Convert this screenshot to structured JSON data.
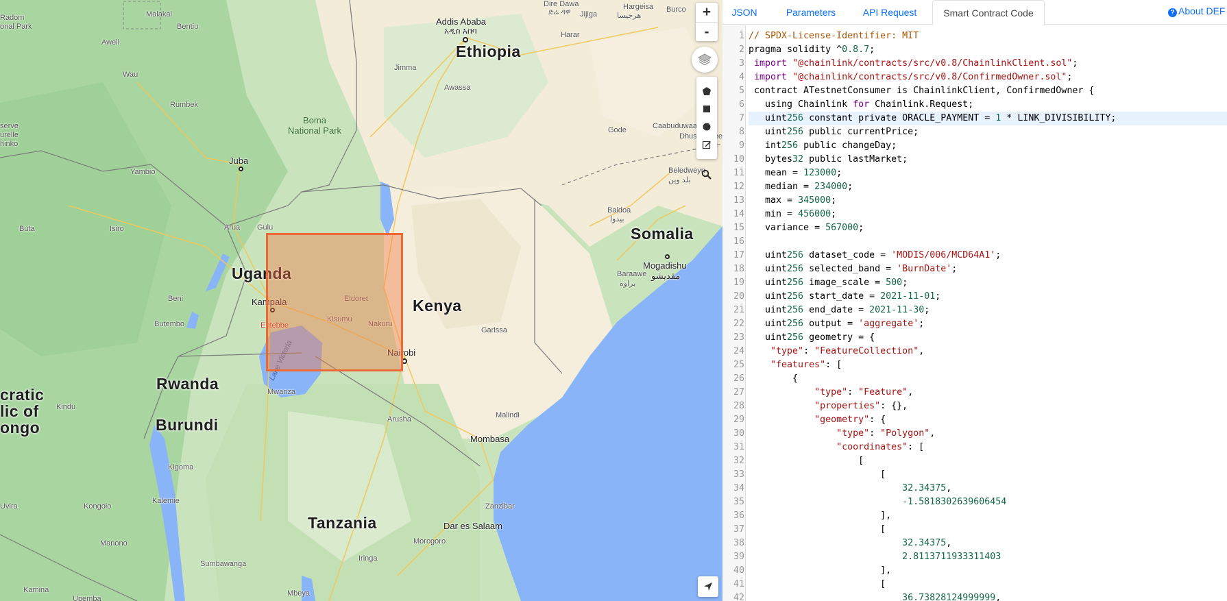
{
  "map": {
    "zoom_in": "+",
    "zoom_out": "-",
    "countries": [
      "Ethiopia",
      "Uganda",
      "Kenya",
      "Somalia",
      "Rwanda",
      "Burundi",
      "Tanzania",
      "cratic",
      "lic of",
      "ongo"
    ],
    "cities": [
      "Addis Ababa",
      "አዲስ አበባ",
      "Juba",
      "Kampala",
      "Nairobi",
      "Mogadishu",
      "مقديشو",
      "Mombasa",
      "Dar es Salaam",
      "Kisumu",
      "Eldoret",
      "Nakuru",
      "Entebbe",
      "Gulu",
      "Mwanza",
      "Arusha",
      "Kigoma",
      "Dire Dawa",
      "ድሬ ዳዋ",
      "Hargeisa",
      "هرجيسا",
      "Jijiga",
      "Harar",
      "Jimma",
      "Awassa",
      "Burco",
      "Baidoa",
      "بيدوا",
      "Beledweyn",
      "بلد وين",
      "Gode",
      "Caabuduwaaq",
      "Dhusamaree",
      "Garissa",
      "Malindi",
      "Baraawe",
      "براوة",
      "Zanzibar",
      "Morogoro",
      "Iringa",
      "Mbeya",
      "Mbeya",
      "Malakal",
      "Wau",
      "Rumbek",
      "Yambio",
      "Arua",
      "Isiro",
      "Buta",
      "Beni",
      "Butembo",
      "Kindu",
      "Kalemie",
      "Manono",
      "Sumbawanga",
      "Kamina",
      "Kongolo",
      "Uvira",
      "Aweil",
      "Bentiu",
      "Radom",
      "onal Park",
      "serve",
      "urelle",
      "hinko",
      "Upemba",
      "Malindi"
    ],
    "parks": [
      "Boma",
      "National Park"
    ],
    "water": [
      "Lake Victoria"
    ]
  },
  "tabs": [
    {
      "label": "JSON",
      "active": false
    },
    {
      "label": "Parameters",
      "active": false
    },
    {
      "label": "API Request",
      "active": false
    },
    {
      "label": "Smart Contract Code",
      "active": true
    }
  ],
  "about_label": "About DEF",
  "code": {
    "lines": [
      "// SPDX-License-Identifier: MIT",
      "pragma solidity ^0.8.7;",
      " import \"@chainlink/contracts/src/v0.8/ChainlinkClient.sol\";",
      " import \"@chainlink/contracts/src/v0.8/ConfirmedOwner.sol\";",
      " contract ATestnetConsumer is ChainlinkClient, ConfirmedOwner {",
      "   using Chainlink for Chainlink.Request;",
      "   uint256 constant private ORACLE_PAYMENT = 1 * LINK_DIVISIBILITY;",
      "   uint256 public currentPrice;",
      "   int256 public changeDay;",
      "   bytes32 public lastMarket;",
      "   mean = 123000;",
      "   median = 234000;",
      "   max = 345000;",
      "   min = 456000;",
      "   variance = 567000;",
      "",
      "   uint256 dataset_code = 'MODIS/006/MCD64A1';",
      "   uint256 selected_band = 'BurnDate';",
      "   uint256 image_scale = 500;",
      "   uint256 start_date = 2021-11-01;",
      "   uint256 end_date = 2021-11-30;",
      "   uint256 output = 'aggregate';",
      "   uint256 geometry = {",
      "    \"type\": \"FeatureCollection\",",
      "    \"features\": [",
      "        {",
      "            \"type\": \"Feature\",",
      "            \"properties\": {},",
      "            \"geometry\": {",
      "                \"type\": \"Polygon\",",
      "                \"coordinates\": [",
      "                    [",
      "                        [",
      "                            32.34375,",
      "                            -1.5818302639606454",
      "                        ],",
      "                        [",
      "                            32.34375,",
      "                            2.8113711933311403",
      "                        ],",
      "                        [",
      "                            36.73828124999999,"
    ],
    "active_line": 7
  },
  "colors": {
    "accent": "#0d6efd",
    "selection_fill": "#f17a42",
    "selection_border": "#ec6a36",
    "land": "#cfe6c4",
    "ocean": "#8ab4f8"
  }
}
